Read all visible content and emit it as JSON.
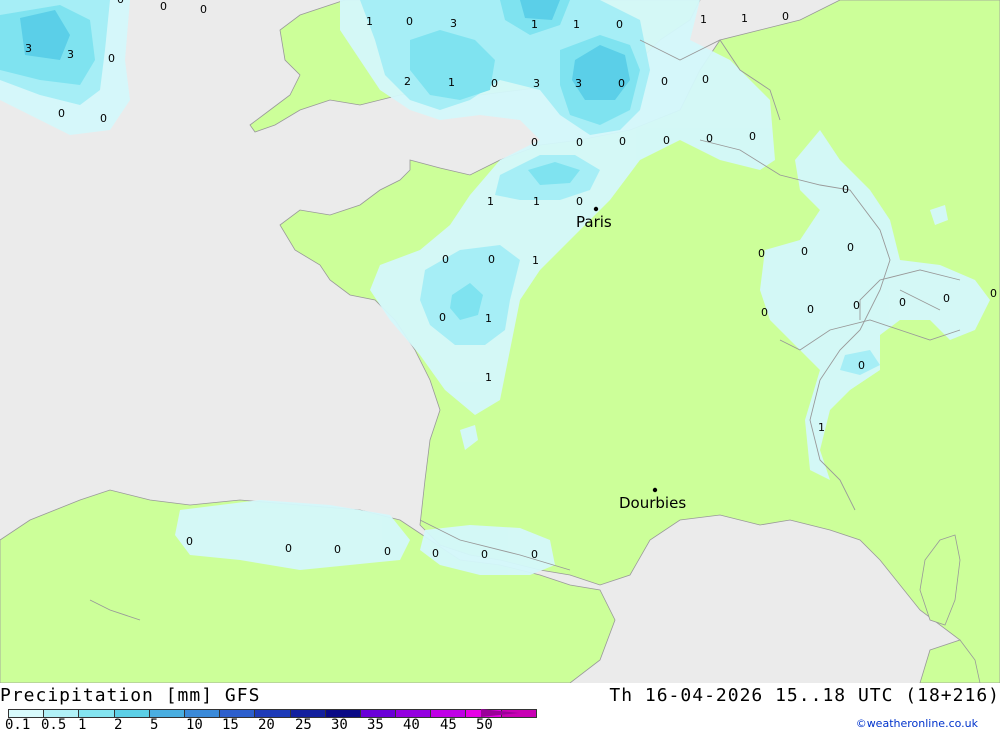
{
  "map": {
    "colors": {
      "sea": "#ebebeb",
      "land": "#ccff99",
      "p01": "#d4f8fb",
      "p05": "#a6eef6",
      "p1": "#7fe3f0",
      "p2": "#5bcfe8",
      "border": "#999999"
    },
    "cities": [
      {
        "name": "Paris"
      },
      {
        "name": "Dourbies"
      }
    ],
    "values": [
      "0",
      "0",
      "0",
      "3",
      "3",
      "0",
      "0",
      "0",
      "1",
      "0",
      "3",
      "1",
      "1",
      "0",
      "1",
      "1",
      "0",
      "2",
      "1",
      "0",
      "3",
      "3",
      "0",
      "0",
      "0",
      "0",
      "0",
      "0",
      "0",
      "0",
      "0",
      "1",
      "1",
      "0",
      "0",
      "0",
      "1",
      "0",
      "1",
      "1",
      "0",
      "0",
      "0",
      "0",
      "0",
      "0",
      "0",
      "0",
      "0",
      "0",
      "0",
      "1",
      "0",
      "0",
      "0",
      "0",
      "0",
      "0",
      "0",
      "0"
    ]
  },
  "header": {
    "title_left": "Precipitation [mm] GFS",
    "title_right": "Th 16-04-2026 15..18 UTC (18+216)"
  },
  "legend": {
    "colors": [
      "#d8fafc",
      "#b1f1f7",
      "#84e4f0",
      "#5ccfe6",
      "#4aaee0",
      "#3b8ad9",
      "#2d5fcd",
      "#1e3bb8",
      "#13209e",
      "#0a0a86",
      "#6a00d8",
      "#9400e0",
      "#bf00e6",
      "#e600e6",
      "#c800b4"
    ],
    "tick_labels": [
      "0.1",
      "0.5",
      "1",
      "2",
      "5",
      "10",
      "15",
      "20",
      "25",
      "30",
      "35",
      "40",
      "45",
      "50"
    ],
    "arrow_color": "#9a0099"
  },
  "credit": "©weatheronline.co.uk"
}
